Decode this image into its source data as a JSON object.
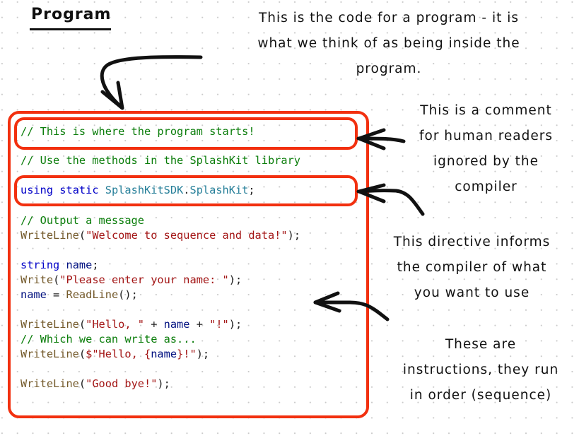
{
  "title": "Program",
  "annotations": {
    "program": [
      "This is the code for a program - it is",
      "what we think of as being inside the",
      "program."
    ],
    "comment": [
      "This is a comment",
      "for human readers",
      "ignored by the",
      "compiler"
    ],
    "directive": [
      "This directive informs",
      "the compiler of what",
      "you want to use"
    ],
    "instructions": [
      "These are",
      "instructions, they run",
      "in order (sequence)"
    ]
  },
  "code": {
    "line1": "// This is where the program starts!",
    "line2": "// Use the methods in the SplashKit library",
    "line3": {
      "kw1": "using",
      "kw2": "static",
      "ns": "SplashKitSDK",
      "dot": ".",
      "cls": "SplashKit",
      "end": ";"
    },
    "line4": "// Output a message",
    "line5": {
      "fn": "WriteLine",
      "open": "(",
      "str": "\"Welcome to sequence and data!\"",
      "close": ");"
    },
    "line6": {
      "kw": "string",
      "var": "name",
      "end": ";"
    },
    "line7": {
      "fn": "Write",
      "open": "(",
      "str": "\"Please enter your name: \"",
      "close": ");"
    },
    "line8": {
      "var": "name",
      "op": " = ",
      "fn": "ReadLine",
      "end": "();"
    },
    "line9": {
      "fn": "WriteLine",
      "open": "(",
      "str1": "\"Hello, \"",
      "op1": " + ",
      "var": "name",
      "op2": " + ",
      "str2": "\"!\"",
      "close": ");"
    },
    "line10": "// Which we can write as...",
    "line11": {
      "fn": "WriteLine",
      "open": "(",
      "str1": "$\"Hello, {",
      "var": "name",
      "str2": "}!\"",
      "close": ");"
    },
    "line12": {
      "fn": "WriteLine",
      "open": "(",
      "str": "\"Good bye!\"",
      "close": ");"
    }
  },
  "colors": {
    "highlight": "#f2300f",
    "comment": "#0a7d0a",
    "keyword": "#0000c8",
    "type": "#267f99",
    "function": "#745a2b",
    "string": "#a31515",
    "variable": "#001080"
  }
}
